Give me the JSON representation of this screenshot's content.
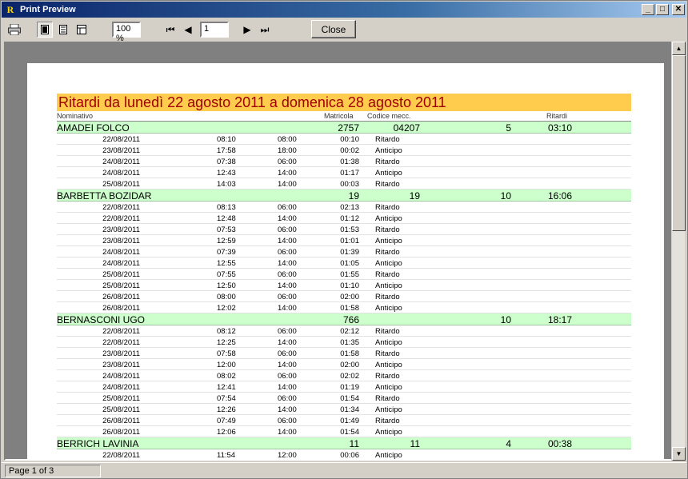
{
  "window": {
    "title": "Print Preview",
    "app_icon": "R"
  },
  "toolbar": {
    "zoom": "100 %",
    "page_number": "1",
    "close_label": "Close"
  },
  "status": {
    "page_info": "Page 1 of 3"
  },
  "report": {
    "title": "Ritardi da lunedì 22 agosto 2011 a domenica 28 agosto 2011",
    "headers": {
      "nominativo": "Nominativo",
      "matricola": "Matricola",
      "codice": "Codice mecc.",
      "ritardi": "Ritardi"
    },
    "groups": [
      {
        "name": "AMADEI FOLCO",
        "matricola": "2757",
        "codice": "04207",
        "count": "5",
        "total": "03:10",
        "rows": [
          [
            "22/08/2011",
            "08:10",
            "08:00",
            "00:10",
            "Ritardo"
          ],
          [
            "23/08/2011",
            "17:58",
            "18:00",
            "00:02",
            "Anticipo"
          ],
          [
            "24/08/2011",
            "07:38",
            "06:00",
            "01:38",
            "Ritardo"
          ],
          [
            "24/08/2011",
            "12:43",
            "14:00",
            "01:17",
            "Anticipo"
          ],
          [
            "25/08/2011",
            "14:03",
            "14:00",
            "00:03",
            "Ritardo"
          ]
        ]
      },
      {
        "name": "BARBETTA BOZIDAR",
        "matricola": "19",
        "codice": "19",
        "count": "10",
        "total": "16:06",
        "rows": [
          [
            "22/08/2011",
            "08:13",
            "06:00",
            "02:13",
            "Ritardo"
          ],
          [
            "22/08/2011",
            "12:48",
            "14:00",
            "01:12",
            "Anticipo"
          ],
          [
            "23/08/2011",
            "07:53",
            "06:00",
            "01:53",
            "Ritardo"
          ],
          [
            "23/08/2011",
            "12:59",
            "14:00",
            "01:01",
            "Anticipo"
          ],
          [
            "24/08/2011",
            "07:39",
            "06:00",
            "01:39",
            "Ritardo"
          ],
          [
            "24/08/2011",
            "12:55",
            "14:00",
            "01:05",
            "Anticipo"
          ],
          [
            "25/08/2011",
            "07:55",
            "06:00",
            "01:55",
            "Ritardo"
          ],
          [
            "25/08/2011",
            "12:50",
            "14:00",
            "01:10",
            "Anticipo"
          ],
          [
            "26/08/2011",
            "08:00",
            "06:00",
            "02:00",
            "Ritardo"
          ],
          [
            "26/08/2011",
            "12:02",
            "14:00",
            "01:58",
            "Anticipo"
          ]
        ]
      },
      {
        "name": "BERNASCONI UGO",
        "matricola": "766",
        "codice": "",
        "count": "10",
        "total": "18:17",
        "rows": [
          [
            "22/08/2011",
            "08:12",
            "06:00",
            "02:12",
            "Ritardo"
          ],
          [
            "22/08/2011",
            "12:25",
            "14:00",
            "01:35",
            "Anticipo"
          ],
          [
            "23/08/2011",
            "07:58",
            "06:00",
            "01:58",
            "Ritardo"
          ],
          [
            "23/08/2011",
            "12:00",
            "14:00",
            "02:00",
            "Anticipo"
          ],
          [
            "24/08/2011",
            "08:02",
            "06:00",
            "02:02",
            "Ritardo"
          ],
          [
            "24/08/2011",
            "12:41",
            "14:00",
            "01:19",
            "Anticipo"
          ],
          [
            "25/08/2011",
            "07:54",
            "06:00",
            "01:54",
            "Ritardo"
          ],
          [
            "25/08/2011",
            "12:26",
            "14:00",
            "01:34",
            "Anticipo"
          ],
          [
            "26/08/2011",
            "07:49",
            "06:00",
            "01:49",
            "Ritardo"
          ],
          [
            "26/08/2011",
            "12:06",
            "14:00",
            "01:54",
            "Anticipo"
          ]
        ]
      },
      {
        "name": "BERRICH LAVINIA",
        "matricola": "11",
        "codice": "11",
        "count": "4",
        "total": "00:38",
        "rows": [
          [
            "22/08/2011",
            "11:54",
            "12:00",
            "00:06",
            "Anticipo"
          ]
        ]
      }
    ]
  }
}
